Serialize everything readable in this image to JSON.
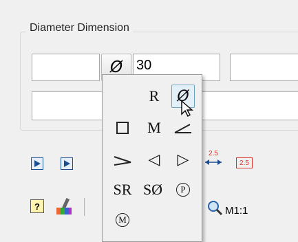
{
  "dialog": {
    "group_title": "Diameter Dimension",
    "prefix_field": "",
    "symbol_button": "Ø",
    "value_field": "30",
    "suffix_field": "",
    "tolerance_field": ""
  },
  "symbol_popup": {
    "items": [
      {
        "name": "radius-symbol",
        "label": "R"
      },
      {
        "name": "diameter-symbol",
        "label": "Ø",
        "selected": true
      },
      {
        "name": "square-symbol",
        "label": ""
      },
      {
        "name": "m-symbol",
        "label": "M"
      },
      {
        "name": "angle-symbol",
        "label": ""
      },
      {
        "name": "slope-symbol",
        "label": ""
      },
      {
        "name": "taper-left-symbol",
        "label": "◁"
      },
      {
        "name": "taper-right-symbol",
        "label": "▷"
      },
      {
        "name": "sr-symbol",
        "label": "SR"
      },
      {
        "name": "sphere-diameter-symbol",
        "label": "SØ"
      },
      {
        "name": "circled-p-symbol",
        "label": "P"
      },
      {
        "name": "circled-m-symbol",
        "label": "M"
      }
    ]
  },
  "toolbar": {
    "scale_label": "M1:1",
    "dim_style_a": "2.5",
    "dim_style_b": "2.5"
  },
  "colors": {
    "accent": "#1b4f8f",
    "selection_bg": "#e3f0f7",
    "red_icon": "#d6312b"
  }
}
